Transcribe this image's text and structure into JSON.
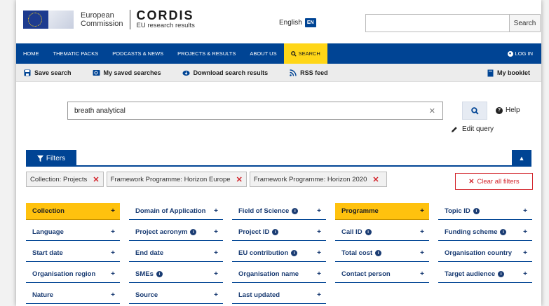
{
  "header": {
    "ec_line1": "European",
    "ec_line2": "Commission",
    "cordis_title": "CORDIS",
    "cordis_sub": "EU research results",
    "language": "English",
    "language_code": "EN",
    "search_button": "Search",
    "search_placeholder": ""
  },
  "nav": {
    "items": [
      {
        "label": "HOME"
      },
      {
        "label": "THEMATIC PACKS"
      },
      {
        "label": "PODCASTS & NEWS"
      },
      {
        "label": "PROJECTS & RESULTS"
      },
      {
        "label": "ABOUT US"
      },
      {
        "label": "SEARCH"
      }
    ],
    "active": "SEARCH",
    "login": "LOG IN"
  },
  "toolbar": {
    "save_search": "Save search",
    "my_saved_searches": "My saved searches",
    "download_results": "Download search results",
    "rss_feed": "RSS feed",
    "my_booklet": "My booklet"
  },
  "search": {
    "value": "breath analytical",
    "help": "Help",
    "edit_query": "Edit query"
  },
  "filters": {
    "tab_label": "Filters",
    "chips": [
      {
        "label": "Collection: Projects"
      },
      {
        "label": "Framework Programme: Horizon Europe"
      },
      {
        "label": "Framework Programme: Horizon 2020"
      }
    ],
    "clear_all": "Clear all filters"
  },
  "facets": [
    {
      "label": "Collection",
      "info": false,
      "active": true
    },
    {
      "label": "Domain of Application",
      "info": false,
      "active": false
    },
    {
      "label": "Field of Science",
      "info": true,
      "active": false
    },
    {
      "label": "Programme",
      "info": false,
      "active": true
    },
    {
      "label": "Topic ID",
      "info": true,
      "active": false
    },
    {
      "label": "Language",
      "info": false,
      "active": false
    },
    {
      "label": "Project acronym",
      "info": true,
      "active": false
    },
    {
      "label": "Project ID",
      "info": true,
      "active": false
    },
    {
      "label": "Call ID",
      "info": true,
      "active": false
    },
    {
      "label": "Funding scheme",
      "info": true,
      "active": false
    },
    {
      "label": "Start date",
      "info": false,
      "active": false
    },
    {
      "label": "End date",
      "info": false,
      "active": false
    },
    {
      "label": "EU contribution",
      "info": true,
      "active": false
    },
    {
      "label": "Total cost",
      "info": true,
      "active": false
    },
    {
      "label": "Organisation country",
      "info": false,
      "active": false
    },
    {
      "label": "Organisation region",
      "info": false,
      "active": false
    },
    {
      "label": "SMEs",
      "info": true,
      "active": false
    },
    {
      "label": "Organisation name",
      "info": false,
      "active": false
    },
    {
      "label": "Contact person",
      "info": false,
      "active": false
    },
    {
      "label": "Target audience",
      "info": true,
      "active": false
    },
    {
      "label": "Nature",
      "info": false,
      "active": false
    },
    {
      "label": "Source",
      "info": false,
      "active": false
    },
    {
      "label": "Last updated",
      "info": false,
      "active": false
    }
  ],
  "colors": {
    "brand_blue": "#004494",
    "active_yellow": "#ffc20e",
    "nav_active": "#ffd617",
    "remove_red": "#d2232a",
    "facet_text": "#1a3c73"
  }
}
